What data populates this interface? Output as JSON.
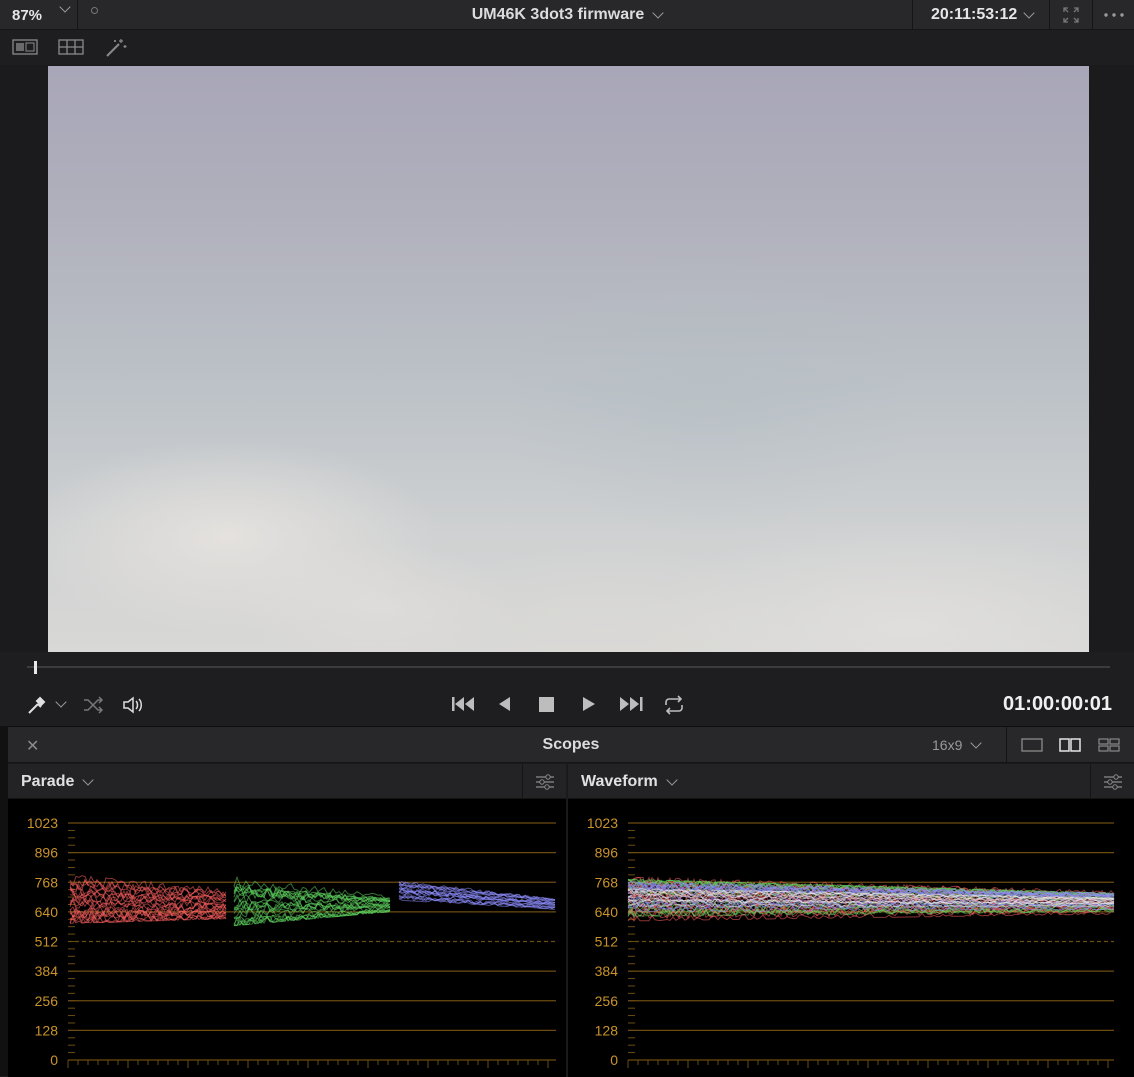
{
  "topbar": {
    "zoom": "87%",
    "clip_title": "UM46K 3dot3 firmware",
    "timecode": "20:11:53:12"
  },
  "transport": {
    "timecode": "01:00:00:01"
  },
  "scopes": {
    "title": "Scopes",
    "aspect": "16x9",
    "left_panel": {
      "name": "Parade",
      "ticks": [
        "1023",
        "896",
        "768",
        "640",
        "512",
        "384",
        "256",
        "128",
        "0"
      ]
    },
    "right_panel": {
      "name": "Waveform",
      "ticks": [
        "1023",
        "896",
        "768",
        "640",
        "512",
        "384",
        "256",
        "128",
        "0"
      ]
    }
  },
  "colors": {
    "tick_text": "#c9932a",
    "grid_line": "#6b4d12",
    "red": "#ff6060",
    "green": "#5ed35e",
    "blue": "#8e8eff"
  },
  "icons": [
    "chevron-down-icon",
    "fullscreen-icon",
    "more-icon",
    "single-viewer-icon",
    "grid-viewer-icon",
    "magic-wand-icon",
    "eyedropper-icon",
    "shuffle-icon",
    "speaker-icon",
    "skip-start-icon",
    "step-back-icon",
    "stop-icon",
    "play-icon",
    "skip-end-icon",
    "loop-icon",
    "close-icon",
    "layout-single-icon",
    "layout-dual-icon",
    "layout-quad-icon",
    "scope-settings-icon"
  ]
}
